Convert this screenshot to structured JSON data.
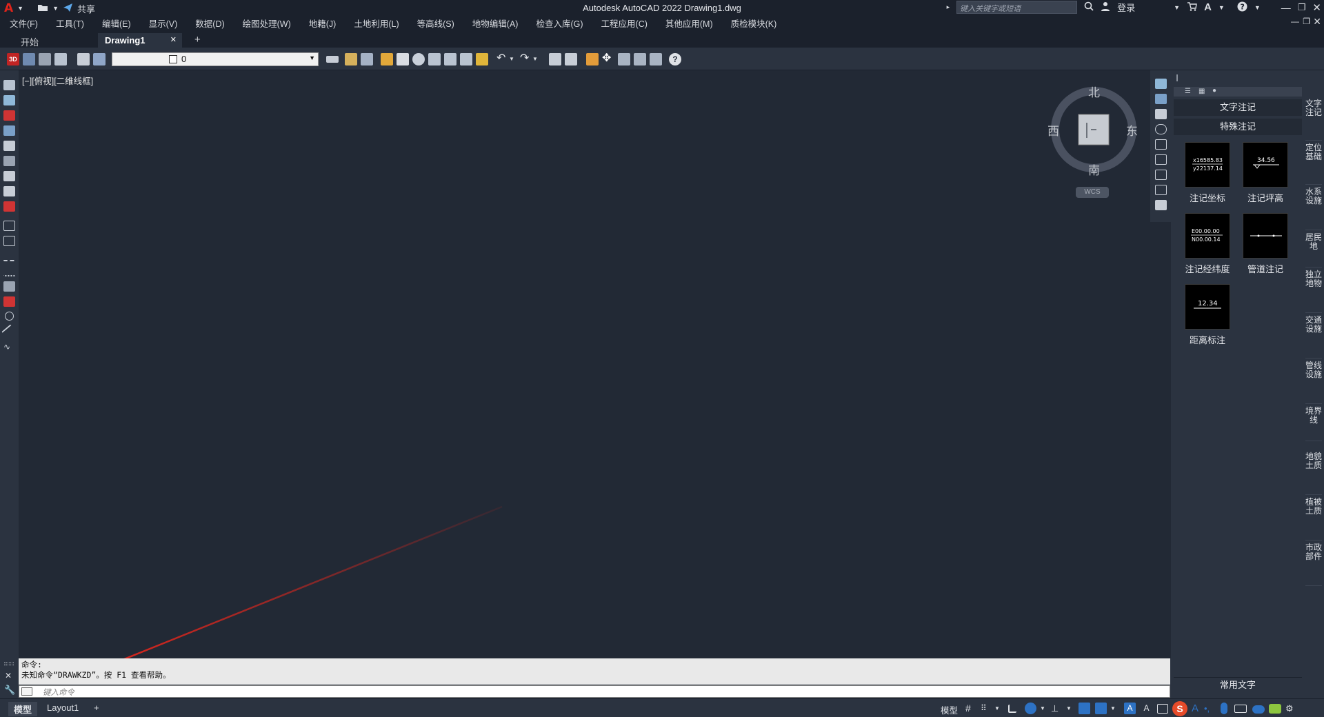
{
  "window": {
    "title": "Autodesk AutoCAD 2022    Drawing1.dwg",
    "share_label": "共享",
    "search_placeholder": "键入关键字或短语",
    "login_label": "登录"
  },
  "menu": [
    "文件(F)",
    "工具(T)",
    "编辑(E)",
    "显示(V)",
    "数据(D)",
    "绘图处理(W)",
    "地籍(J)",
    "土地利用(L)",
    "等高线(S)",
    "地物编辑(A)",
    "检查入库(G)",
    "工程应用(C)",
    "其他应用(M)",
    "质检模块(K)"
  ],
  "tabs": {
    "start": "开始",
    "drawing": "Drawing1",
    "close": "✕",
    "add": "+"
  },
  "toolbar": {
    "layer_value": "0"
  },
  "viewport": {
    "label": "[−][俯视][二维线框]"
  },
  "viewcube": {
    "north": "北",
    "south": "南",
    "east": "东",
    "west": "西",
    "wcs": "WCS"
  },
  "right_panel": {
    "header1": "文字注记",
    "header2": "特殊注记",
    "items": [
      {
        "label": "注记坐标",
        "preview": "x16585.83\ny22137.14"
      },
      {
        "label": "注记坪高",
        "preview": "34.56"
      },
      {
        "label": "注记经纬度",
        "preview": "E00.00.00\nN00.00.14"
      },
      {
        "label": "管道注记",
        "preview": "—·—"
      },
      {
        "label": "距离标注",
        "preview": "12.34"
      }
    ],
    "footer": "常用文字"
  },
  "vertical_tabs": [
    "文字注记",
    "定位基础",
    "水系设施",
    "居民地",
    "独立地物",
    "交通设施",
    "管线设施",
    "境界线",
    "地貌土质",
    "植被土质",
    "市政部件"
  ],
  "command": {
    "line1": "命令:",
    "line2": "未知命令“DRAWKZD”。按 F1 查看帮助。",
    "input_placeholder": "键入命令"
  },
  "status": {
    "model_tab": "模型",
    "layout_tab": "Layout1",
    "add": "+",
    "model_label": "模型"
  },
  "colors": {
    "background": "#222935",
    "panel": "#2b3340",
    "annotation_arrow": "#e2261c"
  }
}
